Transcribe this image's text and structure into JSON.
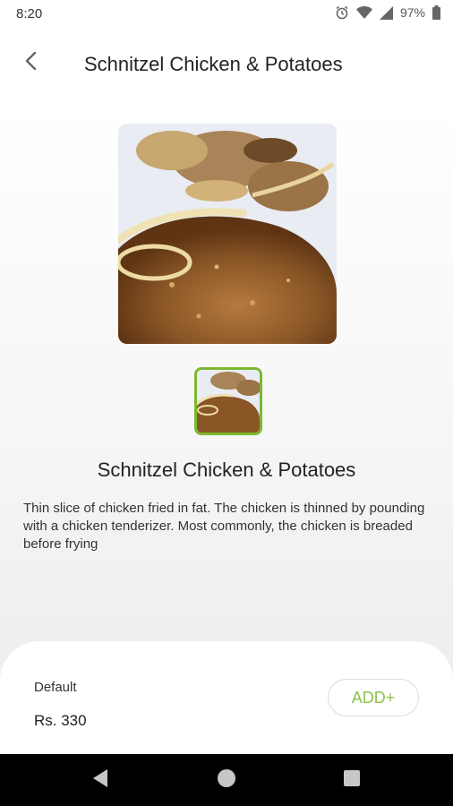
{
  "status_bar": {
    "time": "8:20",
    "battery": "97%",
    "icons": [
      "alarm-icon",
      "wifi-icon",
      "signal-icon",
      "battery-icon"
    ]
  },
  "app_bar": {
    "back_icon": "chevron-left-icon",
    "title": "Schnitzel Chicken & Potatoes"
  },
  "product": {
    "name": "Schnitzel Chicken & Potatoes",
    "description": "Thin slice of chicken fried in fat. The chicken is thinned by pounding with a chicken tenderizer. Most commonly, the chicken is breaded before frying"
  },
  "order": {
    "variant_label": "Default",
    "price": "Rs. 330",
    "add_label": "ADD+",
    "accent_color": "#8bc34a"
  },
  "nav_bar": {
    "icons": [
      "back-triangle-icon",
      "home-circle-icon",
      "recents-square-icon"
    ]
  }
}
